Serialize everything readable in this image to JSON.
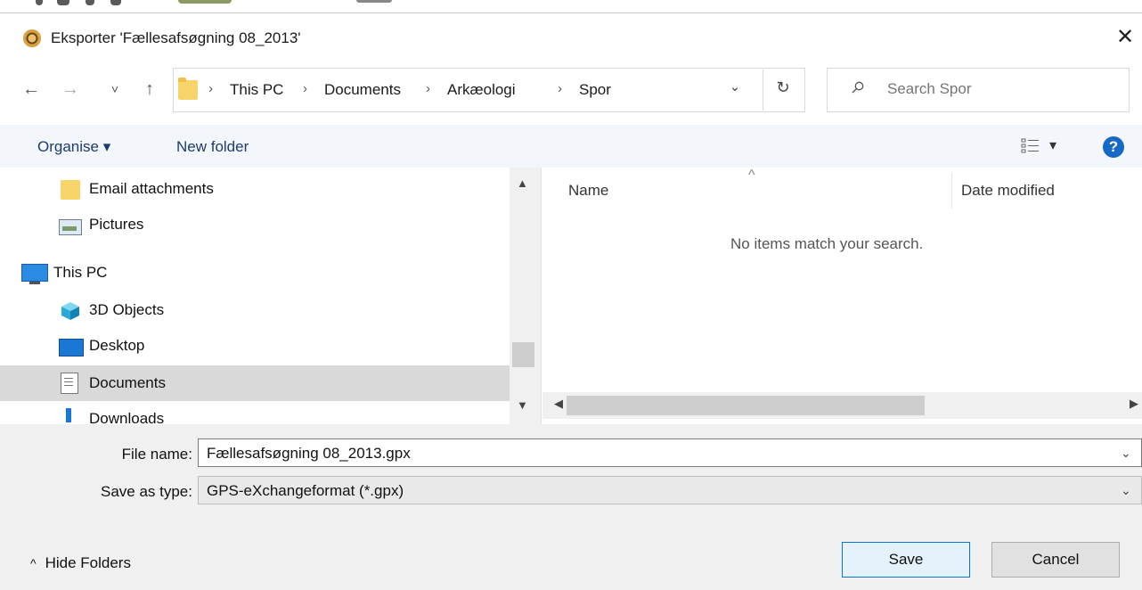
{
  "window": {
    "title": "Eksporter 'Fællesafsøgning 08_2013'",
    "close_glyph": "✕",
    "app_icon": "app-icon"
  },
  "nav": {
    "back_glyph": "←",
    "forward_glyph": "→",
    "recent_glyph": "˅",
    "up_glyph": "↑",
    "breadcrumb": [
      "This PC",
      "Documents",
      "Arkæologi",
      "Spor"
    ],
    "separator": "›",
    "dropdown_glyph": "⌄",
    "refresh_glyph": "↻",
    "search_placeholder": "Search Spor"
  },
  "toolbar": {
    "organise_label": "Organise ▾",
    "new_folder_label": "New folder",
    "view_dropdown_glyph": "▾",
    "help_label": "?"
  },
  "sidebar": {
    "items": [
      {
        "label": "Email attachments",
        "icon": "folder-icon"
      },
      {
        "label": "Pictures",
        "icon": "pictures-icon"
      },
      {
        "label": "This PC",
        "icon": "computer-icon"
      },
      {
        "label": "3D Objects",
        "icon": "3d-objects-icon"
      },
      {
        "label": "Desktop",
        "icon": "desktop-icon"
      },
      {
        "label": "Documents",
        "icon": "documents-icon",
        "selected": true
      },
      {
        "label": "Downloads",
        "icon": "downloads-icon"
      }
    ]
  },
  "files": {
    "sort_glyph": "^",
    "columns": [
      "Name",
      "Date modified"
    ],
    "empty_message": "No items match your search."
  },
  "form": {
    "file_name_label": "File name:",
    "file_name_value": "Fællesafsøgning 08_2013.gpx",
    "save_type_label": "Save as type:",
    "save_type_value": "GPS-eXchangeformat (*.gpx)",
    "chevron": "⌄"
  },
  "footer": {
    "hide_folders_label": "Hide Folders",
    "hide_folders_glyph": "^",
    "save_label": "Save",
    "cancel_label": "Cancel"
  },
  "colors": {
    "accent": "#0078d7",
    "link": "#1e3b6e",
    "help": "#1769c8",
    "selection": "#d9d9d9"
  }
}
